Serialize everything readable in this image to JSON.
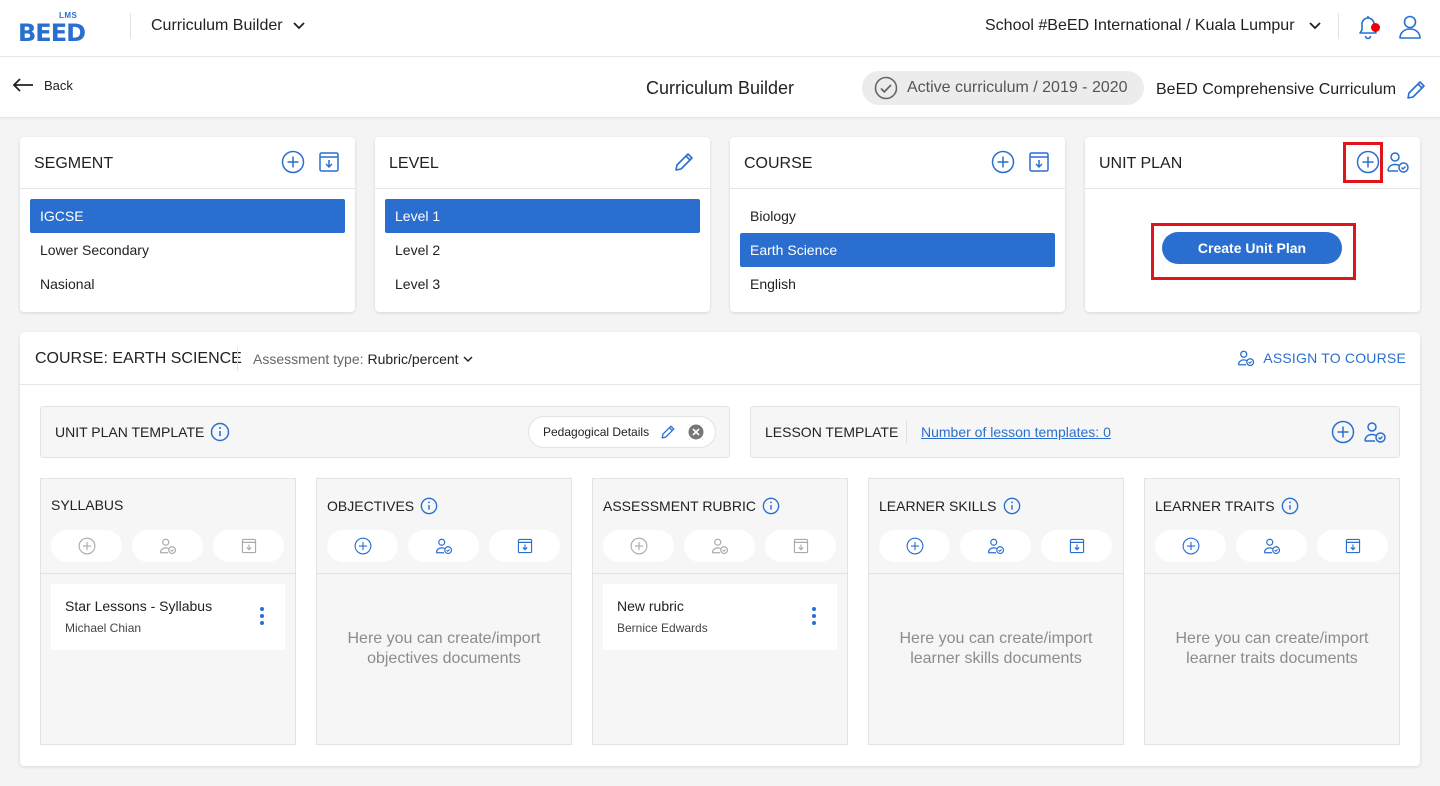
{
  "header": {
    "logo_small": "LMS",
    "logo_word": "BEED",
    "app_name": "Curriculum Builder",
    "school": "School #BeED International / Kuala Lumpur"
  },
  "subbar": {
    "back": "Back",
    "title": "Curriculum Builder",
    "active_status": "Active curriculum / 2019 - 2020",
    "curriculum_name": "BeED Comprehensive Curriculum"
  },
  "segment": {
    "title": "SEGMENT",
    "items": [
      "IGCSE",
      "Lower Secondary",
      "Nasional"
    ],
    "selected": 0
  },
  "level": {
    "title": "LEVEL",
    "items": [
      "Level 1",
      "Level 2",
      "Level 3"
    ],
    "selected": 0
  },
  "course": {
    "title": "COURSE",
    "items": [
      "Biology",
      "Earth Science",
      "English"
    ],
    "selected": 1
  },
  "unit_plan": {
    "title": "UNIT PLAN",
    "create_button": "Create Unit Plan"
  },
  "panel": {
    "course_title": "COURSE: EARTH SCIENCE",
    "assessment_label": "Assessment type:",
    "assessment_value": "Rubric/percent",
    "assign": "ASSIGN TO COURSE",
    "unit_plan_template": "UNIT PLAN TEMPLATE",
    "chip": "Pedagogical Details",
    "lesson_template": "LESSON TEMPLATE",
    "lesson_link": "Number of lesson templates: 0"
  },
  "columns": [
    {
      "title": "SYLLABUS",
      "doc_title": "Star Lessons - Syllabus",
      "doc_author": "Michael Chian"
    },
    {
      "title": "OBJECTIVES",
      "empty": "Here you can create/import objectives documents"
    },
    {
      "title": "ASSESSMENT RUBRIC",
      "doc_title": "New rubric",
      "doc_author": "Bernice Edwards"
    },
    {
      "title": "LEARNER SKILLS",
      "empty": "Here you can create/import learner skills documents"
    },
    {
      "title": "LEARNER TRAITS",
      "empty": "Here you can create/import learner traits documents"
    }
  ],
  "colors": {
    "accent": "#2a6fcf",
    "highlight": "#e0151b",
    "notification": "#ee0000"
  }
}
